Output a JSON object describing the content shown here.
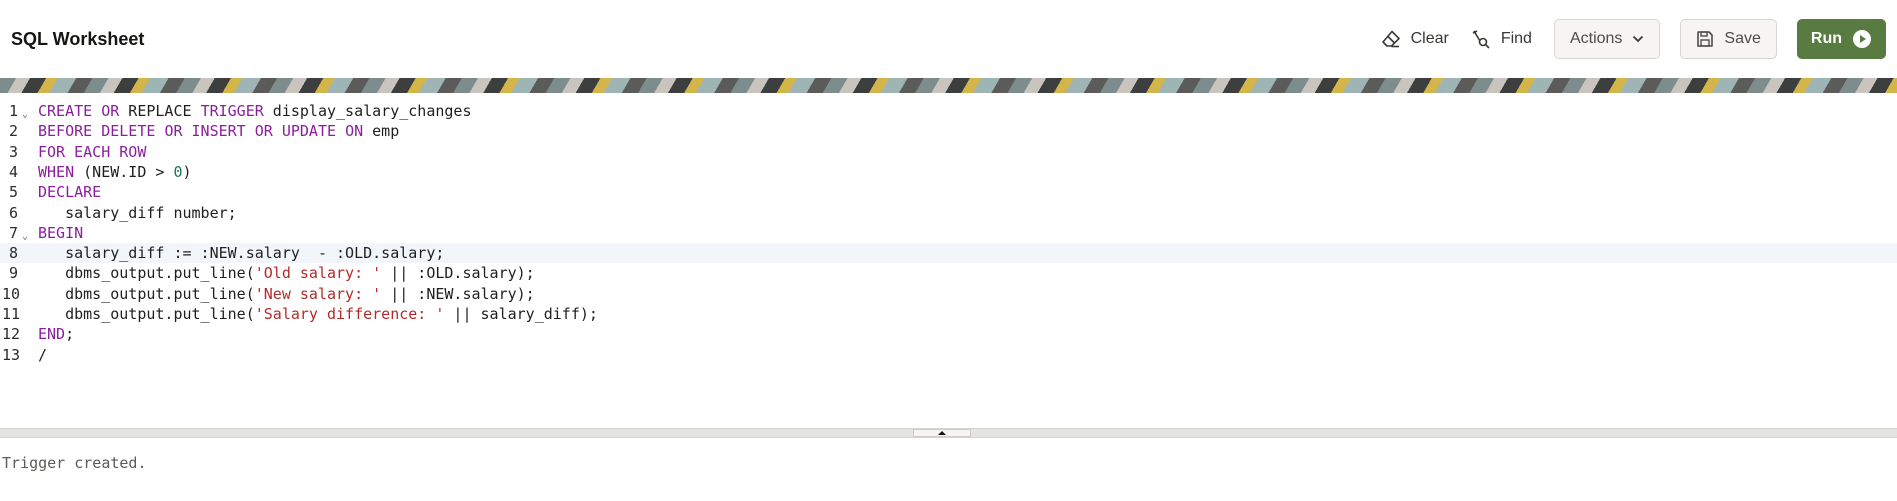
{
  "header": {
    "title": "SQL Worksheet"
  },
  "toolbar": {
    "clear_label": "Clear",
    "find_label": "Find",
    "actions_label": "Actions",
    "save_label": "Save",
    "run_label": "Run"
  },
  "editor": {
    "active_line": 8,
    "lines": [
      {
        "n": "1",
        "fold": true,
        "tokens": [
          [
            "kw",
            "CREATE"
          ],
          [
            "t",
            " "
          ],
          [
            "kw",
            "OR"
          ],
          [
            "t",
            " REPLACE "
          ],
          [
            "kw",
            "TRIGGER"
          ],
          [
            "t",
            " display_salary_changes"
          ]
        ]
      },
      {
        "n": "2",
        "tokens": [
          [
            "kw",
            "BEFORE"
          ],
          [
            "t",
            " "
          ],
          [
            "kw",
            "DELETE"
          ],
          [
            "t",
            " "
          ],
          [
            "kw",
            "OR"
          ],
          [
            "t",
            " "
          ],
          [
            "kw",
            "INSERT"
          ],
          [
            "t",
            " "
          ],
          [
            "kw",
            "OR"
          ],
          [
            "t",
            " "
          ],
          [
            "kw",
            "UPDATE"
          ],
          [
            "t",
            " "
          ],
          [
            "kw",
            "ON"
          ],
          [
            "t",
            " emp"
          ]
        ]
      },
      {
        "n": "3",
        "tokens": [
          [
            "kw",
            "FOR"
          ],
          [
            "t",
            " "
          ],
          [
            "kw",
            "EACH"
          ],
          [
            "t",
            " "
          ],
          [
            "kw",
            "ROW"
          ]
        ]
      },
      {
        "n": "4",
        "tokens": [
          [
            "kw",
            "WHEN"
          ],
          [
            "t",
            " (NEW.ID > "
          ],
          [
            "num",
            "0"
          ],
          [
            "t",
            ")"
          ]
        ]
      },
      {
        "n": "5",
        "tokens": [
          [
            "kw",
            "DECLARE"
          ]
        ]
      },
      {
        "n": "6",
        "tokens": [
          [
            "t",
            "   salary_diff number;"
          ]
        ]
      },
      {
        "n": "7",
        "fold": true,
        "tokens": [
          [
            "kw",
            "BEGIN"
          ]
        ]
      },
      {
        "n": "8",
        "tokens": [
          [
            "t",
            "   salary_diff := :NEW.salary  - :OLD.salary;"
          ]
        ]
      },
      {
        "n": "9",
        "tokens": [
          [
            "t",
            "   dbms_output.put_line("
          ],
          [
            "str",
            "'Old salary: '"
          ],
          [
            "t",
            " || :OLD.salary);"
          ]
        ]
      },
      {
        "n": "10",
        "tokens": [
          [
            "t",
            "   dbms_output.put_line("
          ],
          [
            "str",
            "'New salary: '"
          ],
          [
            "t",
            " || :NEW.salary);"
          ]
        ]
      },
      {
        "n": "11",
        "tokens": [
          [
            "t",
            "   dbms_output.put_line("
          ],
          [
            "str",
            "'Salary difference: '"
          ],
          [
            "t",
            " || salary_diff);"
          ]
        ]
      },
      {
        "n": "12",
        "tokens": [
          [
            "kw",
            "END"
          ],
          [
            "t",
            ";"
          ]
        ]
      },
      {
        "n": "13",
        "tokens": [
          [
            "t",
            "/"
          ]
        ]
      }
    ]
  },
  "output": {
    "text": "Trigger created."
  },
  "icons": {
    "clear": "eraser-icon",
    "find": "find-icon",
    "actions": "chevron-down-icon",
    "save": "save-icon",
    "run": "play-icon",
    "splitter": "chevron-up-icon"
  },
  "colors": {
    "run_button": "#587b42",
    "keyword": "#8b1e9e",
    "string": "#b22b2b",
    "number": "#167a50"
  }
}
